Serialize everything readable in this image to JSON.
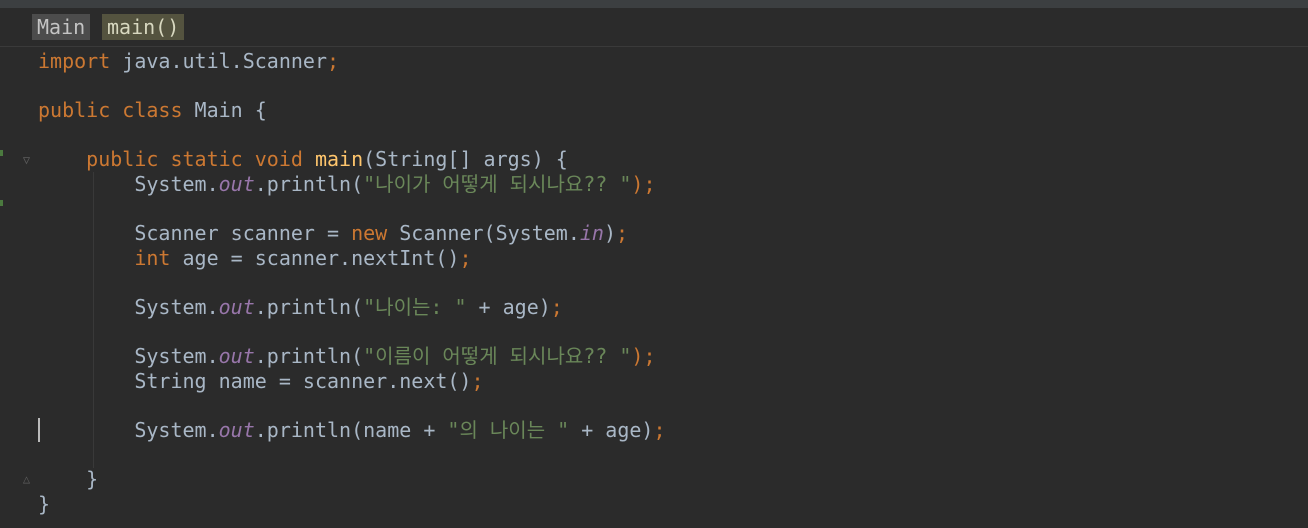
{
  "breadcrumb": {
    "class_name": "Main",
    "method_name": "main()"
  },
  "code": {
    "lines": [
      {
        "tokens": [
          {
            "t": "import",
            "k": "kw"
          },
          {
            "t": " java.util.Scanner",
            "k": "txt"
          },
          {
            "t": ";",
            "k": "kw"
          }
        ]
      },
      {
        "tokens": []
      },
      {
        "tokens": [
          {
            "t": "public class",
            "k": "kw"
          },
          {
            "t": " Main {",
            "k": "txt"
          }
        ]
      },
      {
        "tokens": []
      },
      {
        "tokens": [
          {
            "t": "    ",
            "k": "txt"
          },
          {
            "t": "public static void",
            "k": "kw"
          },
          {
            "t": " ",
            "k": "txt"
          },
          {
            "t": "main",
            "k": "fn"
          },
          {
            "t": "(String[] args) {",
            "k": "txt"
          }
        ]
      },
      {
        "tokens": [
          {
            "t": "        System.",
            "k": "txt"
          },
          {
            "t": "out",
            "k": "fld"
          },
          {
            "t": ".println(",
            "k": "txt"
          },
          {
            "t": "\"나이가 어떻게 되시나요?? \"",
            "k": "str"
          },
          {
            "t": ");",
            "k": "kw"
          }
        ]
      },
      {
        "tokens": []
      },
      {
        "tokens": [
          {
            "t": "        Scanner scanner = ",
            "k": "txt"
          },
          {
            "t": "new",
            "k": "kw"
          },
          {
            "t": " Scanner(System.",
            "k": "txt"
          },
          {
            "t": "in",
            "k": "fld"
          },
          {
            "t": ")",
            "k": "txt"
          },
          {
            "t": ";",
            "k": "kw"
          }
        ]
      },
      {
        "tokens": [
          {
            "t": "        ",
            "k": "txt"
          },
          {
            "t": "int",
            "k": "kw"
          },
          {
            "t": " age = scanner.nextInt()",
            "k": "txt"
          },
          {
            "t": ";",
            "k": "kw"
          }
        ]
      },
      {
        "tokens": []
      },
      {
        "tokens": [
          {
            "t": "        System.",
            "k": "txt"
          },
          {
            "t": "out",
            "k": "fld"
          },
          {
            "t": ".println(",
            "k": "txt"
          },
          {
            "t": "\"나이는: \"",
            "k": "str"
          },
          {
            "t": " + age)",
            "k": "txt"
          },
          {
            "t": ";",
            "k": "kw"
          }
        ]
      },
      {
        "tokens": []
      },
      {
        "tokens": [
          {
            "t": "        System.",
            "k": "txt"
          },
          {
            "t": "out",
            "k": "fld"
          },
          {
            "t": ".println(",
            "k": "txt"
          },
          {
            "t": "\"이름이 어떻게 되시나요?? \"",
            "k": "str"
          },
          {
            "t": ");",
            "k": "kw"
          }
        ]
      },
      {
        "tokens": [
          {
            "t": "        String name = scanner.next()",
            "k": "txt"
          },
          {
            "t": ";",
            "k": "kw"
          }
        ]
      },
      {
        "tokens": []
      },
      {
        "tokens": [
          {
            "t": "        System.",
            "k": "txt"
          },
          {
            "t": "out",
            "k": "fld"
          },
          {
            "t": ".println(name + ",
            "k": "txt"
          },
          {
            "t": "\"의 나이는 \"",
            "k": "str"
          },
          {
            "t": " + age)",
            "k": "txt"
          },
          {
            "t": ";",
            "k": "kw"
          }
        ]
      },
      {
        "tokens": []
      },
      {
        "tokens": [
          {
            "t": "    }",
            "k": "txt"
          }
        ]
      },
      {
        "tokens": [
          {
            "t": "}",
            "k": "txt"
          }
        ]
      }
    ]
  },
  "colors": {
    "background": "#2b2b2b",
    "keyword": "#cc7832",
    "function": "#ffc66d",
    "string": "#6a8759",
    "field": "#9876aa",
    "text": "#a9b7c6"
  },
  "icons": {
    "fold_open": "fold-open-icon",
    "fold_close": "fold-close-icon"
  }
}
